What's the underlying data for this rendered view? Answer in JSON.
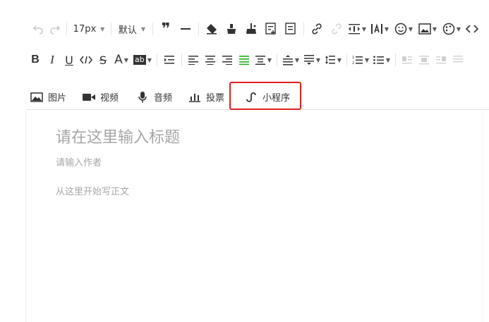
{
  "toolbar_row1": {
    "font_size": "17px",
    "font_family": "默认"
  },
  "insert_bar": {
    "image_label": "图片",
    "video_label": "视频",
    "audio_label": "音频",
    "vote_label": "投票",
    "miniprogram_label": "小程序"
  },
  "editor": {
    "title_placeholder": "请在这里输入标题",
    "author_placeholder": "请输入作者",
    "body_placeholder": "从这里开始写正文"
  },
  "colors": {
    "highlight_border": "#e0201c",
    "placeholder": "#a6a6a6",
    "align_active": "#1aad19"
  }
}
